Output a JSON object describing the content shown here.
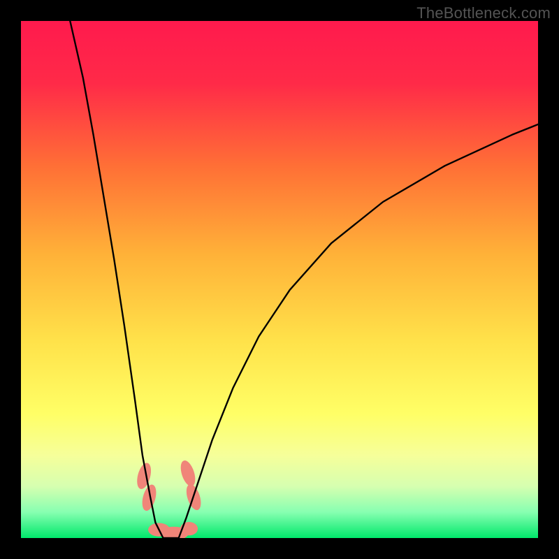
{
  "watermark": "TheBottleneck.com",
  "chart_data": {
    "type": "line",
    "title": "",
    "xlabel": "",
    "ylabel": "",
    "xlim": [
      0,
      100
    ],
    "ylim": [
      0,
      100
    ],
    "grid": false,
    "legend": false,
    "background": {
      "style": "vertical-gradient",
      "stops": [
        {
          "offset": 0.0,
          "color": "#ff1a4d"
        },
        {
          "offset": 0.12,
          "color": "#ff2a48"
        },
        {
          "offset": 0.28,
          "color": "#ff6f36"
        },
        {
          "offset": 0.45,
          "color": "#ffb138"
        },
        {
          "offset": 0.62,
          "color": "#ffe24a"
        },
        {
          "offset": 0.76,
          "color": "#ffff66"
        },
        {
          "offset": 0.84,
          "color": "#f6ff9a"
        },
        {
          "offset": 0.9,
          "color": "#d6ffb0"
        },
        {
          "offset": 0.95,
          "color": "#87ffb1"
        },
        {
          "offset": 1.0,
          "color": "#00e86b"
        }
      ]
    },
    "series": [
      {
        "name": "curve-left",
        "color": "#000000",
        "x": [
          9.5,
          12,
          14,
          16,
          18,
          20,
          22,
          23.5,
          25,
          26,
          27.5
        ],
        "y": [
          100,
          89,
          78,
          66,
          54,
          41,
          27,
          16,
          8,
          3,
          0
        ]
      },
      {
        "name": "curve-right",
        "color": "#000000",
        "x": [
          30.5,
          32,
          34,
          37,
          41,
          46,
          52,
          60,
          70,
          82,
          95,
          100
        ],
        "y": [
          0,
          4,
          10,
          19,
          29,
          39,
          48,
          57,
          65,
          72,
          78,
          80
        ]
      },
      {
        "name": "valley-floor",
        "color": "#000000",
        "x": [
          27.5,
          28.5,
          29.5,
          30.5
        ],
        "y": [
          0,
          0,
          0,
          0
        ]
      }
    ],
    "markers": [
      {
        "shape": "blob",
        "cx": 23.8,
        "cy": 12.0,
        "rx": 1.2,
        "ry": 2.6,
        "rot": 15,
        "color": "#f08579"
      },
      {
        "shape": "blob",
        "cx": 24.8,
        "cy": 7.8,
        "rx": 1.2,
        "ry": 2.6,
        "rot": 15,
        "color": "#f08579"
      },
      {
        "shape": "blob",
        "cx": 32.3,
        "cy": 12.5,
        "rx": 1.2,
        "ry": 2.6,
        "rot": -18,
        "color": "#f08579"
      },
      {
        "shape": "blob",
        "cx": 33.4,
        "cy": 7.9,
        "rx": 1.2,
        "ry": 2.6,
        "rot": -18,
        "color": "#f08579"
      },
      {
        "shape": "blob",
        "cx": 26.7,
        "cy": 1.6,
        "rx": 2.1,
        "ry": 1.3,
        "rot": 0,
        "color": "#f08579"
      },
      {
        "shape": "blob",
        "cx": 29.6,
        "cy": 0.9,
        "rx": 2.8,
        "ry": 1.3,
        "rot": 0,
        "color": "#f08579"
      },
      {
        "shape": "blob",
        "cx": 32.5,
        "cy": 1.8,
        "rx": 1.7,
        "ry": 1.3,
        "rot": 0,
        "color": "#f08579"
      }
    ]
  }
}
